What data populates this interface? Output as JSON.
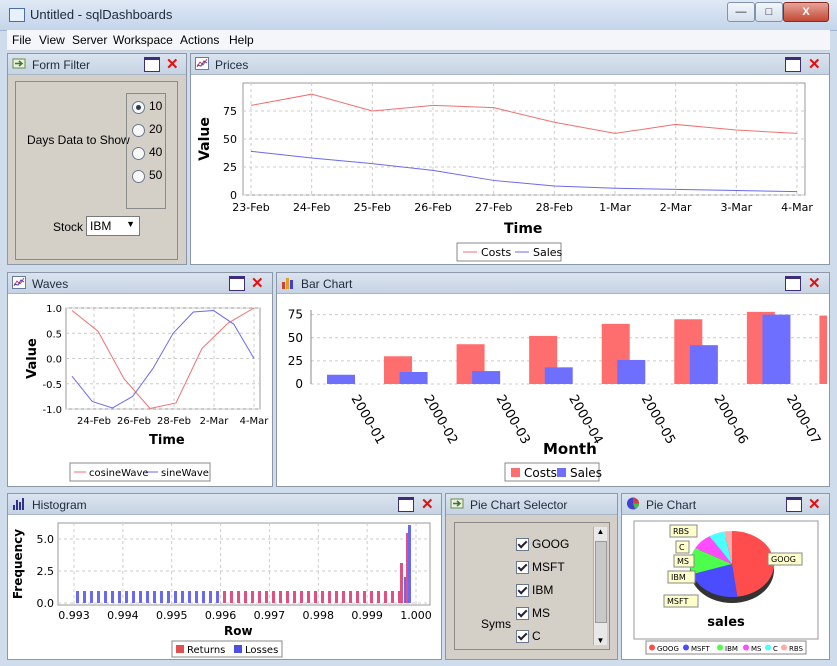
{
  "window": {
    "title": "Untitled - sqlDashboards",
    "min": "—",
    "max": "□",
    "close": "X"
  },
  "menu": [
    "File",
    "View",
    "Server",
    "Workspace",
    "Actions",
    "Help"
  ],
  "formFilter": {
    "title": "Form Filter",
    "daysLabel": "Days Data to Show",
    "days": [
      "10",
      "20",
      "40",
      "50"
    ],
    "stockLabel": "Stock",
    "stock": "IBM"
  },
  "prices": {
    "title": "Prices"
  },
  "waves": {
    "title": "Waves"
  },
  "barChart": {
    "title": "Bar Chart"
  },
  "histogram": {
    "title": "Histogram"
  },
  "pieSelector": {
    "title": "Pie Chart Selector",
    "label": "Syms",
    "syms": [
      "GOOG",
      "MSFT",
      "IBM",
      "MS",
      "C"
    ]
  },
  "pieChart": {
    "title": "Pie Chart"
  },
  "colors": {
    "red": "#f07070",
    "blue": "#6a6af0",
    "barRed": "#ff6e6e",
    "barBlue": "#6e6eff"
  },
  "chart_data": [
    {
      "id": "prices",
      "type": "line",
      "x": [
        "23-Feb",
        "24-Feb",
        "25-Feb",
        "26-Feb",
        "27-Feb",
        "28-Feb",
        "1-Mar",
        "2-Mar",
        "3-Mar",
        "4-Mar"
      ],
      "series": [
        {
          "name": "Costs",
          "values": [
            80,
            90,
            75,
            80,
            78,
            65,
            55,
            63,
            58,
            55
          ]
        },
        {
          "name": "Sales",
          "values": [
            39,
            33,
            28,
            22,
            13,
            8,
            6,
            5,
            4,
            3
          ]
        }
      ],
      "xlabel": "Time",
      "ylabel": "Value",
      "ylim": [
        0,
        100
      ],
      "yticks": [
        "0",
        "25",
        "50",
        "75"
      ]
    },
    {
      "id": "waves",
      "type": "line",
      "x": [
        "24-Feb",
        "26-Feb",
        "28-Feb",
        "2-Mar",
        "4-Mar"
      ],
      "series": [
        {
          "name": "cosineWave",
          "values": [
            0.95,
            0.54,
            -0.4,
            -0.99,
            -0.88,
            0.2,
            0.7,
            1.0
          ]
        },
        {
          "name": "sineWave",
          "values": [
            -0.35,
            -0.85,
            -0.98,
            -0.75,
            -0.2,
            0.5,
            0.92,
            0.95,
            0.68,
            0.0
          ]
        }
      ],
      "xlabel": "Time",
      "ylabel": "Value",
      "ylim": [
        -1,
        1
      ],
      "yticks": [
        "1.0",
        "0.5",
        "0.0",
        "-0.5",
        "-1.0"
      ]
    },
    {
      "id": "bar",
      "type": "bar",
      "categories": [
        "2000-01",
        "2000-02",
        "2000-03",
        "2000-04",
        "2000-05",
        "2000-06",
        "2000-07"
      ],
      "series": [
        {
          "name": "Costs",
          "values": [
            30,
            43,
            52,
            65,
            70,
            78,
            74
          ]
        },
        {
          "name": "Sales",
          "values": [
            10,
            13,
            14,
            18,
            26,
            42,
            75
          ]
        }
      ],
      "xlabel": "Month",
      "ylim": [
        0,
        80
      ],
      "yticks": [
        "0",
        "25",
        "50",
        "75"
      ]
    },
    {
      "id": "histogram",
      "type": "bar",
      "xticks": [
        "0.993",
        "0.994",
        "0.995",
        "0.996",
        "0.997",
        "0.998",
        "0.999",
        "1.000"
      ],
      "series": [
        {
          "name": "Returns"
        },
        {
          "name": "Losses"
        }
      ],
      "xlabel": "Row",
      "ylabel": "Frequency",
      "yticks": [
        "0.0",
        "2.5",
        "5.0"
      ]
    },
    {
      "id": "pie",
      "type": "pie",
      "title": "sales",
      "labels": [
        "GOOG",
        "MSFT",
        "IBM",
        "MS",
        "C",
        "RBS"
      ],
      "values": [
        48,
        22,
        13,
        8,
        6,
        3
      ],
      "colors": [
        "#ff4c4c",
        "#4c4cff",
        "#4cff4c",
        "#ff4cff",
        "#4cffff",
        "#ffaaaa"
      ]
    }
  ]
}
